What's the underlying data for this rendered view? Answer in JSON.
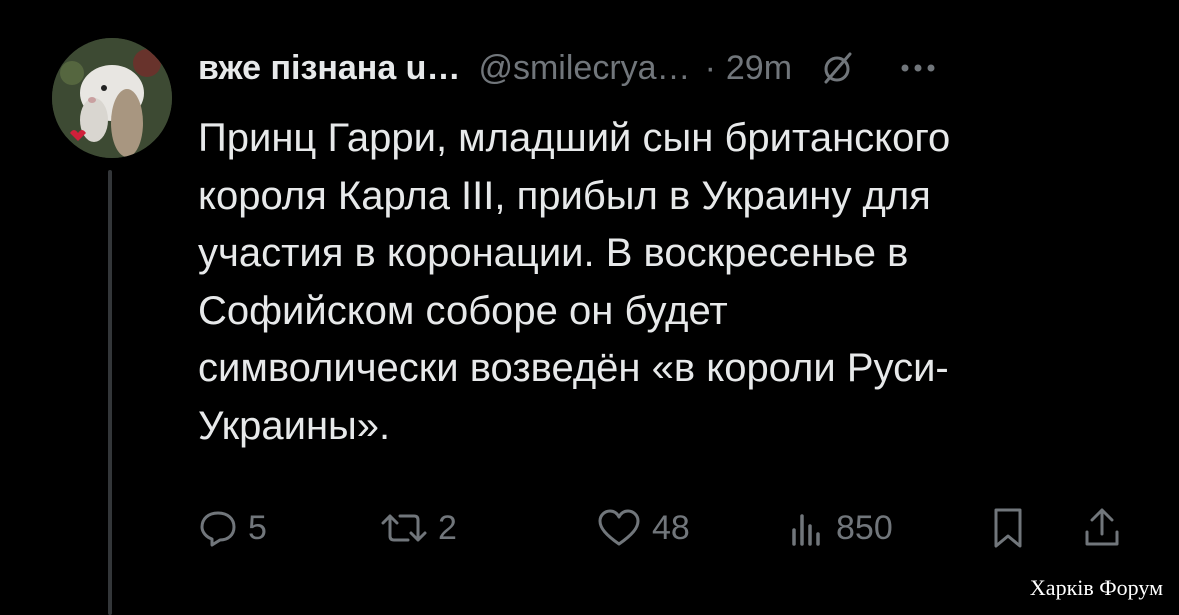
{
  "post": {
    "display_name": "вже пізнана u…",
    "handle": "@smilecrya…",
    "separator": "·",
    "timestamp": "29m",
    "text": "Принц Гарри, младший сын британского\nкороля Карла III, прибыл в Украину для\nучастия в коронации. В воскресенье в\nСофийском соборе он будет\nсимволически возведён «в короли Руси-\nУкраины»."
  },
  "actions": {
    "replies": "5",
    "reposts": "2",
    "likes": "48",
    "views": "850"
  },
  "icons": {
    "avatar": "avatar-rabbit",
    "grok": "grok-icon",
    "more": "more-icon",
    "reply": "reply-icon",
    "repost": "repost-icon",
    "like": "heart-icon",
    "views": "views-icon",
    "bookmark": "bookmark-icon",
    "share": "share-icon"
  },
  "watermark": "Харків Форум",
  "colors": {
    "background": "#000000",
    "text": "#e7e9ea",
    "muted": "#71767b"
  }
}
